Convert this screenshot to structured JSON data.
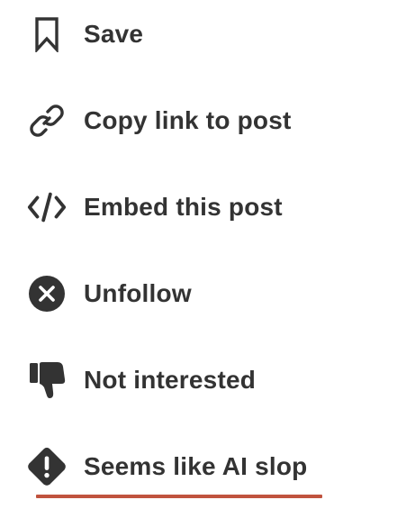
{
  "menu": {
    "items": [
      {
        "id": "save",
        "label": "Save",
        "icon": "bookmark-icon"
      },
      {
        "id": "copy-link",
        "label": "Copy link to post",
        "icon": "link-icon"
      },
      {
        "id": "embed",
        "label": "Embed this post",
        "icon": "code-icon"
      },
      {
        "id": "unfollow",
        "label": "Unfollow",
        "icon": "close-circle-icon"
      },
      {
        "id": "not-interested",
        "label": "Not interested",
        "icon": "thumbs-down-icon"
      },
      {
        "id": "ai-slop",
        "label": "Seems like AI slop",
        "icon": "warning-diamond-icon"
      }
    ]
  },
  "colors": {
    "text": "#333333",
    "icon": "#333333",
    "underline": "#c0533e"
  }
}
